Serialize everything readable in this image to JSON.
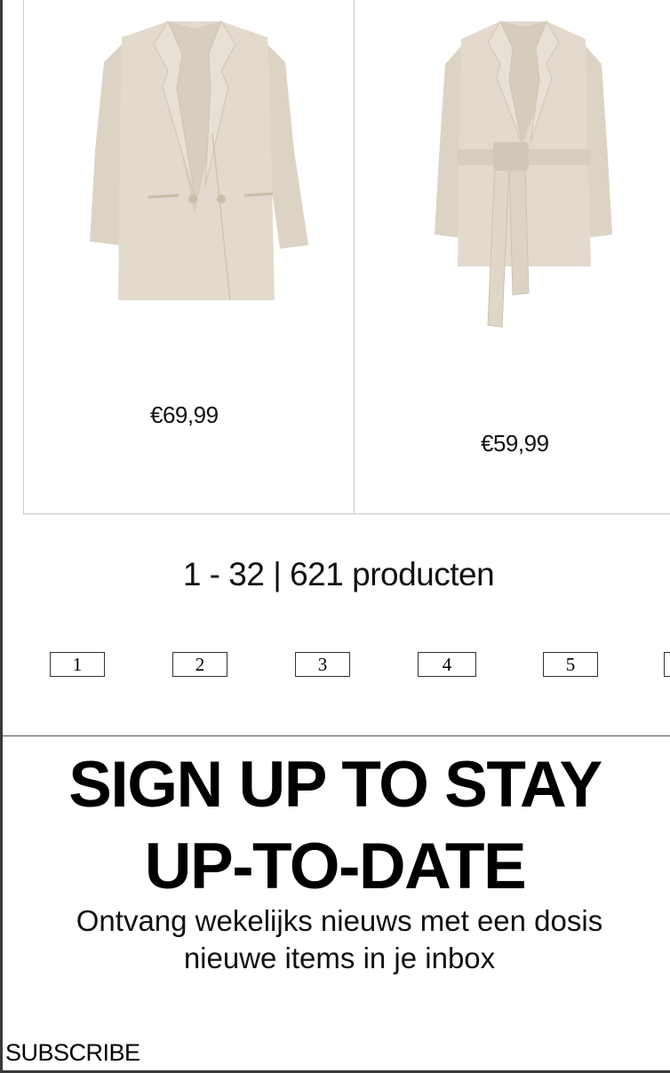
{
  "products": [
    {
      "price": "€69,99",
      "image_icon": "double-breasted-blazer-image"
    },
    {
      "price": "€59,99",
      "image_icon": "belted-wrap-blazer-image"
    }
  ],
  "results": {
    "count_text": "1 - 32 | 621 producten"
  },
  "pagination": {
    "pages": [
      "1",
      "2",
      "3",
      "4",
      "5"
    ]
  },
  "newsletter": {
    "headline_line1": "SIGN UP TO STAY",
    "headline_line2": "UP-TO-DATE",
    "subtext_line1": "Ontvang wekelijks nieuws met een dosis",
    "subtext_line2": "nieuwe items in je inbox",
    "subscribe_label": "SUBSCRIBE"
  },
  "colors": {
    "fabric": "#e3dacd",
    "fabric_shadow": "#d3c8b8",
    "border": "#c8c8c8"
  }
}
